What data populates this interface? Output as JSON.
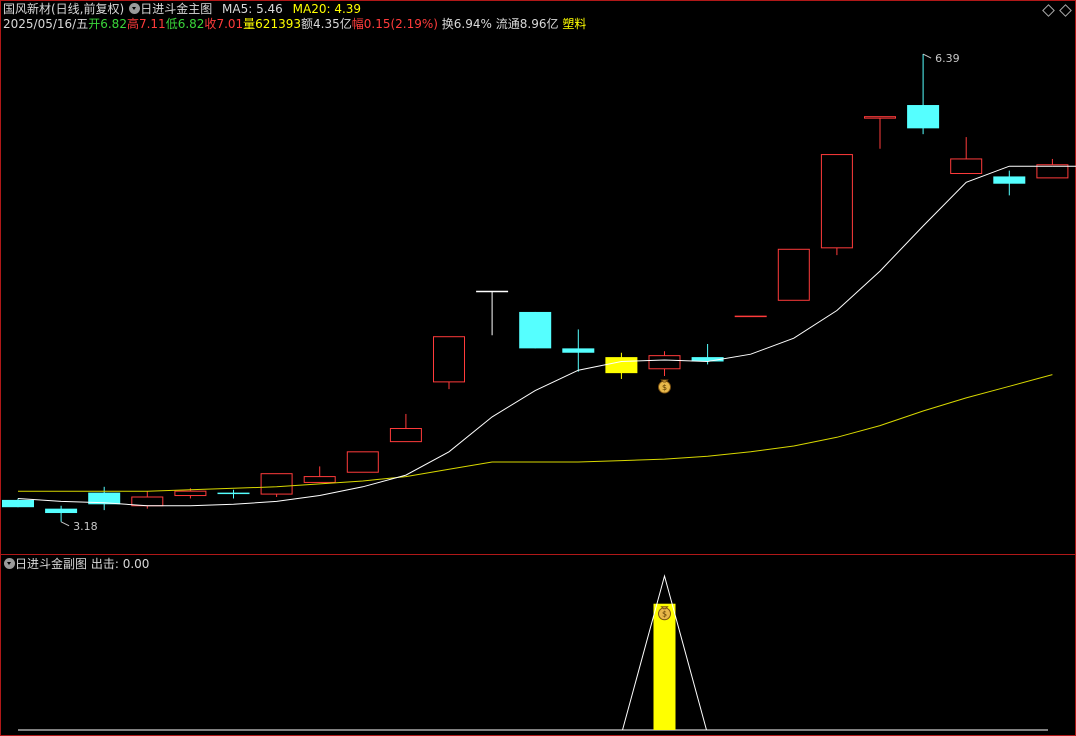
{
  "header": {
    "stock_name": "国风新材(日线,前复权)",
    "indicator_name": "日进斗金主图",
    "ma5_label": "MA5: 5.46",
    "ma20_label": "MA20: 4.39",
    "date": "2025/05/16/五",
    "open_label": "开",
    "open_value": "6.82",
    "high_label": "高",
    "high_value": "7.11",
    "low_label": "低",
    "low_value": "6.82",
    "close_label": "收",
    "close_value": "7.01",
    "volume_label": "量",
    "volume_value": "621393",
    "amount_label": "额",
    "amount_value": "4.35亿",
    "change_label": "幅",
    "change_value": "0.15(2.19%)",
    "turnover_label": "换",
    "turnover_value": "6.94%",
    "float_label": "流通",
    "float_value": "8.96亿",
    "sector": "塑料"
  },
  "sub_header": {
    "indicator_name": "日进斗金副图",
    "output_label": "出击: 0.00"
  },
  "colors": {
    "up": "#ff3b3b",
    "down": "#55ffff",
    "signal": "#ffff00",
    "ma5": "#ffffff",
    "ma20": "#d8d800",
    "border": "#b01818"
  },
  "icons": [
    "money-bag-icon",
    "settings-diamond-icon"
  ],
  "chart_data": {
    "type": "candlestick",
    "y_range": [
      3.0,
      6.5
    ],
    "annotations": [
      {
        "text": "6.39",
        "candle_index": 21,
        "kind": "high"
      },
      {
        "text": "3.18",
        "candle_index": 1,
        "kind": "low"
      }
    ],
    "candles": [
      {
        "open": 3.33,
        "close": 3.28,
        "high": 3.34,
        "low": 3.28,
        "dir": "down"
      },
      {
        "open": 3.27,
        "close": 3.24,
        "high": 3.29,
        "low": 3.18,
        "dir": "down"
      },
      {
        "open": 3.38,
        "close": 3.3,
        "high": 3.42,
        "low": 3.26,
        "dir": "down"
      },
      {
        "open": 3.29,
        "close": 3.35,
        "high": 3.39,
        "low": 3.27,
        "dir": "up"
      },
      {
        "open": 3.36,
        "close": 3.39,
        "high": 3.41,
        "low": 3.34,
        "dir": "up"
      },
      {
        "open": 3.38,
        "close": 3.37,
        "high": 3.4,
        "low": 3.34,
        "dir": "down"
      },
      {
        "open": 3.37,
        "close": 3.51,
        "high": 3.51,
        "low": 3.35,
        "dir": "up"
      },
      {
        "open": 3.45,
        "close": 3.49,
        "high": 3.56,
        "low": 3.45,
        "dir": "up"
      },
      {
        "open": 3.52,
        "close": 3.66,
        "high": 3.66,
        "low": 3.52,
        "dir": "up"
      },
      {
        "open": 3.73,
        "close": 3.82,
        "high": 3.92,
        "low": 3.73,
        "dir": "up"
      },
      {
        "open": 4.14,
        "close": 4.45,
        "high": 4.45,
        "low": 4.09,
        "dir": "up"
      },
      {
        "open": 4.76,
        "close": 4.76,
        "high": 4.76,
        "low": 4.46,
        "dir": "flat"
      },
      {
        "open": 4.62,
        "close": 4.37,
        "high": 4.62,
        "low": 4.37,
        "dir": "down"
      },
      {
        "open": 4.37,
        "close": 4.34,
        "high": 4.5,
        "low": 4.21,
        "dir": "down"
      },
      {
        "open": 4.31,
        "close": 4.2,
        "high": 4.34,
        "low": 4.16,
        "dir": "signal"
      },
      {
        "open": 4.23,
        "close": 4.32,
        "high": 4.35,
        "low": 4.18,
        "dir": "up"
      },
      {
        "open": 4.31,
        "close": 4.28,
        "high": 4.4,
        "low": 4.26,
        "dir": "down"
      },
      {
        "open": 4.59,
        "close": 4.59,
        "high": 4.59,
        "low": 4.59,
        "dir": "flat"
      },
      {
        "open": 4.7,
        "close": 5.05,
        "high": 5.05,
        "low": 4.7,
        "dir": "up"
      },
      {
        "open": 5.06,
        "close": 5.7,
        "high": 5.7,
        "low": 5.01,
        "dir": "up"
      },
      {
        "open": 5.95,
        "close": 5.96,
        "high": 5.96,
        "low": 5.74,
        "dir": "up"
      },
      {
        "open": 6.04,
        "close": 5.88,
        "high": 6.39,
        "low": 5.84,
        "dir": "down"
      },
      {
        "open": 5.57,
        "close": 5.67,
        "high": 5.82,
        "low": 5.57,
        "dir": "up"
      },
      {
        "open": 5.55,
        "close": 5.5,
        "high": 5.59,
        "low": 5.42,
        "dir": "down"
      },
      {
        "open": 5.54,
        "close": 5.63,
        "high": 5.67,
        "low": 5.54,
        "dir": "up"
      }
    ],
    "ma5": [
      3.34,
      3.32,
      3.31,
      3.29,
      3.29,
      3.3,
      3.32,
      3.36,
      3.42,
      3.5,
      3.66,
      3.9,
      4.08,
      4.22,
      4.28,
      4.29,
      4.28,
      4.33,
      4.44,
      4.63,
      4.9,
      5.21,
      5.51,
      5.62,
      5.62
    ],
    "ma20": [
      3.39,
      3.39,
      3.39,
      3.39,
      3.4,
      3.41,
      3.42,
      3.44,
      3.46,
      3.49,
      3.54,
      3.59,
      3.59,
      3.59,
      3.6,
      3.61,
      3.63,
      3.66,
      3.7,
      3.76,
      3.84,
      3.94,
      4.03,
      4.11,
      4.19
    ],
    "signal_candle_index": 15,
    "sub_chart": {
      "type": "bar_and_line",
      "signal_index": 15,
      "bar_value": 0.82,
      "peak_value": 1.0,
      "baseline": 0.0
    }
  }
}
